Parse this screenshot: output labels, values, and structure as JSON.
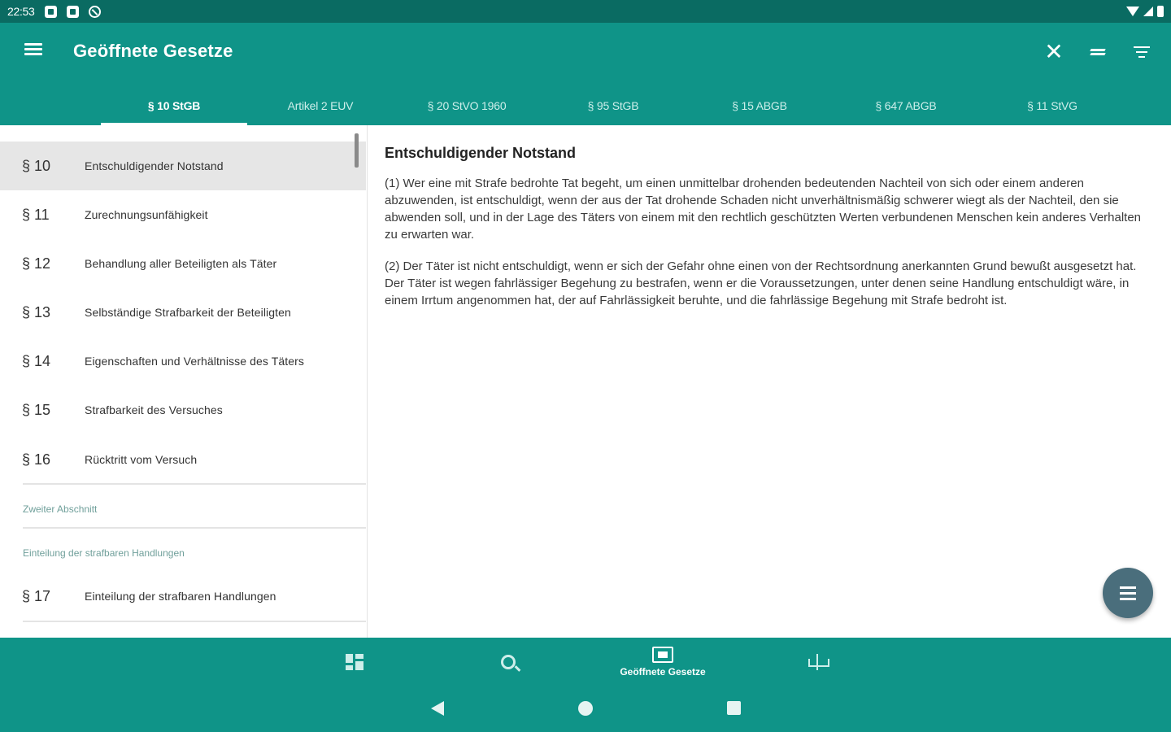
{
  "statusbar": {
    "time": "22:53"
  },
  "appbar": {
    "title": "Geöffnete Gesetze"
  },
  "tabs": [
    {
      "label": "§ 10 StGB"
    },
    {
      "label": "Artikel 2 EUV"
    },
    {
      "label": "§ 20 StVO 1960"
    },
    {
      "label": "§ 95 StGB"
    },
    {
      "label": "§ 15 ABGB"
    },
    {
      "label": "§ 647 ABGB"
    },
    {
      "label": "§ 11 StVG"
    }
  ],
  "list": {
    "items": [
      {
        "num": "§ 10",
        "title": "Entschuldigender Notstand"
      },
      {
        "num": "§ 11",
        "title": "Zurechnungsunfähigkeit"
      },
      {
        "num": "§ 12",
        "title": "Behandlung aller Beteiligten als Täter"
      },
      {
        "num": "§ 13",
        "title": "Selbständige Strafbarkeit der Beteiligten"
      },
      {
        "num": "§ 14",
        "title": "Eigenschaften und Verhältnisse des Täters"
      },
      {
        "num": "§ 15",
        "title": "Strafbarkeit des Versuches"
      },
      {
        "num": "§ 16",
        "title": "Rücktritt vom Versuch"
      },
      {
        "num": "§ 17",
        "title": "Einteilung der strafbaren Handlungen"
      }
    ],
    "sections": [
      "Zweiter Abschnitt",
      "Einteilung der strafbaren Handlungen"
    ]
  },
  "content": {
    "heading": "Entschuldigender Notstand",
    "paragraphs": [
      "(1) Wer eine mit Strafe bedrohte Tat begeht, um einen unmittelbar drohenden bedeutenden Nachteil von sich oder einem anderen abzuwenden, ist entschuldigt, wenn der aus der Tat drohende Schaden nicht unverhältnismäßig schwerer wiegt als der Nachteil, den sie abwenden soll, und in der Lage des Täters von einem mit den rechtlich geschützten Werten verbundenen Menschen kein anderes Verhalten zu erwarten war.",
      "(2) Der Täter ist nicht entschuldigt, wenn er sich der Gefahr ohne einen von der Rechtsordnung anerkannten Grund bewußt ausgesetzt hat. Der Täter ist wegen fahrlässiger Begehung zu bestrafen, wenn er die Voraussetzungen, unter denen seine Handlung entschuldigt wäre, in einem Irrtum angenommen hat, der auf Fahrlässigkeit beruhte, und die fahrlässige Begehung mit Strafe bedroht ist."
    ]
  },
  "bottomnav": {
    "open_label": "Geöffnete Gesetze"
  }
}
